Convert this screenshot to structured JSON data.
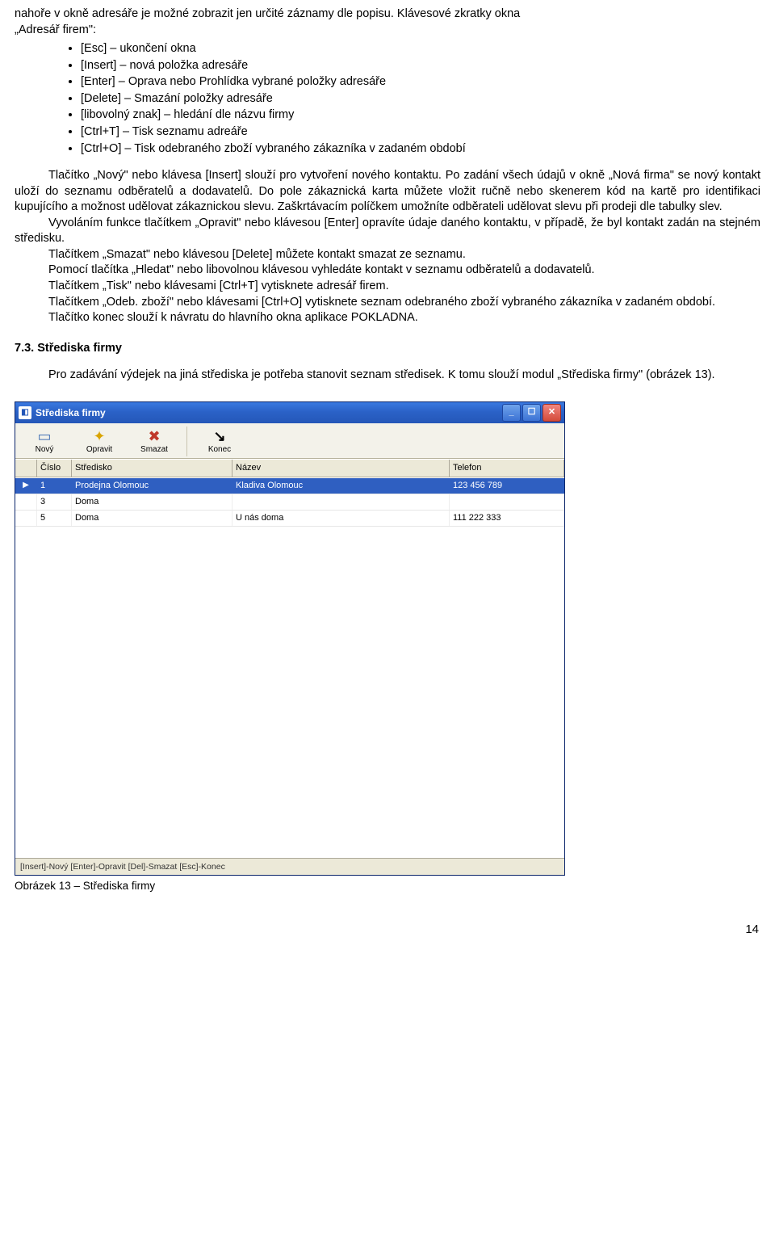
{
  "intro_line1": "nahoře v okně adresáře je možné zobrazit jen určité záznamy dle popisu. Klávesové zkratky okna",
  "intro_line2": "„Adresář firem\":",
  "bullets": [
    "[Esc] – ukončení okna",
    "[Insert] – nová položka adresáře",
    "[Enter] – Oprava nebo Prohlídka vybrané položky adresáře",
    "[Delete] – Smazání položky adresáře",
    "[libovolný znak] – hledání dle názvu firmy",
    "[Ctrl+T] – Tisk seznamu adreáře",
    "[Ctrl+O] – Tisk odebraného zboží vybraného zákazníka v zadaném období"
  ],
  "block1": "Tlačítko „Nový\" nebo klávesa [Insert] slouží pro vytvoření nového kontaktu. Po zadání všech údajů v okně „Nová firma\" se nový kontakt uloží do seznamu odběratelů a dodavatelů. Do pole zákaznická karta můžete vložit ručně nebo skenerem kód na kartě pro identifikaci kupujícího a možnost udělovat zákaznickou slevu. Zaškrtávacím políčkem umožníte odběrateli udělovat slevu při prodeji dle tabulky slev.",
  "block2": "Vyvoláním funkce tlačítkem „Opravit\" nebo klávesou [Enter] opravíte údaje daného kontaktu, v případě, že byl kontakt zadán na stejném středisku.",
  "block3": "Tlačítkem „Smazat\" nebo klávesou [Delete] můžete kontakt smazat ze seznamu.",
  "block4": "Pomocí tlačítka „Hledat\" nebo libovolnou klávesou vyhledáte kontakt v seznamu odběratelů a dodavatelů.",
  "block5": "Tlačítkem „Tisk\" nebo klávesami [Ctrl+T] vytisknete adresář firem.",
  "block6": "Tlačítkem „Odeb. zboží\" nebo klávesami [Ctrl+O] vytisknete seznam odebraného zboží vybraného zákazníka v zadaném období.",
  "block7": "Tlačítko konec slouží k návratu do hlavního okna aplikace POKLADNA.",
  "section_heading": "7.3. Střediska firmy",
  "section_text": "Pro zadávání výdejek na jiná střediska je potřeba stanovit seznam středisek. K tomu slouží modul „Střediska firmy\" (obrázek 13).",
  "window": {
    "title": "Střediska firmy",
    "toolbar": {
      "novy": "Nový",
      "opravit": "Opravit",
      "smazat": "Smazat",
      "konec": "Konec"
    },
    "headers": {
      "cislo": "Číslo",
      "stredisko": "Středisko",
      "nazev": "Název",
      "telefon": "Telefon"
    },
    "rows": [
      {
        "cislo": "1",
        "stredisko": "Prodejna Olomouc",
        "nazev": "Kladiva Olomouc",
        "telefon": "123 456 789",
        "selected": true
      },
      {
        "cislo": "3",
        "stredisko": "Doma",
        "nazev": "",
        "telefon": "",
        "selected": false
      },
      {
        "cislo": "5",
        "stredisko": "Doma",
        "nazev": "U nás doma",
        "telefon": "111 222 333",
        "selected": false
      }
    ],
    "status": "[Insert]-Nový [Enter]-Opravit [Del]-Smazat  [Esc]-Konec"
  },
  "caption": "Obrázek 13 – Střediska firmy",
  "page_number": "14"
}
